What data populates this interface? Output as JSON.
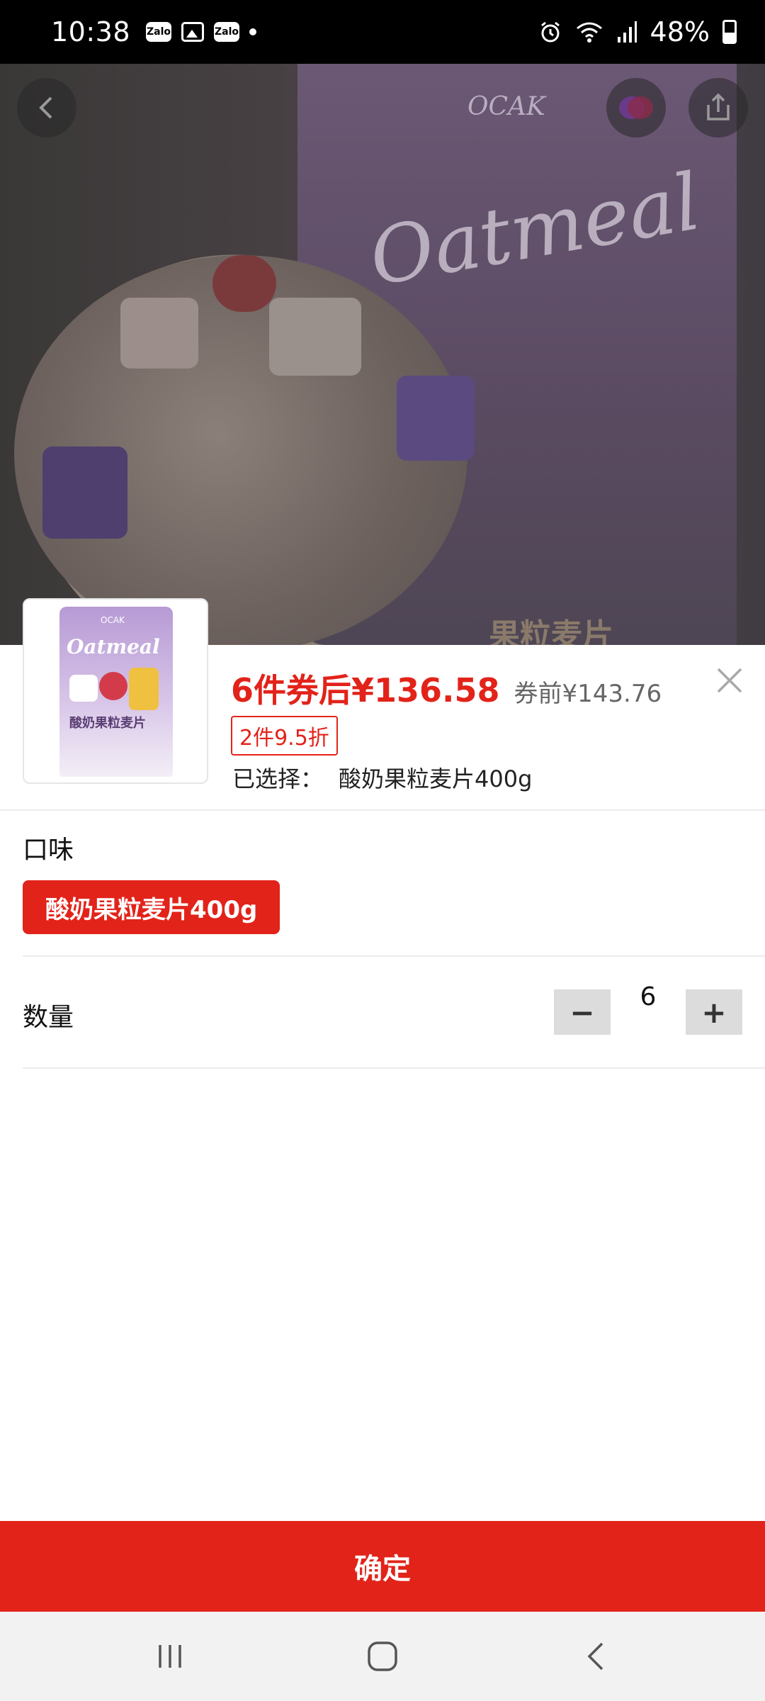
{
  "status_bar": {
    "time": "10:38",
    "notifications": [
      "zalo-icon",
      "gallery-icon",
      "zalo-icon",
      "dot-icon"
    ],
    "zalo_text": "Zalo",
    "battery": "48%",
    "icons": [
      "alarm-icon",
      "wifi-icon",
      "signal-icon",
      "battery-icon"
    ]
  },
  "hero": {
    "brand": "OCAK",
    "script_text": "Oatmeal",
    "package_text": "果粒麦片",
    "buttons": [
      "back-icon",
      "chat-icon",
      "share-icon"
    ]
  },
  "sheet": {
    "price_main": "6件券后¥136.58",
    "price_before": "券前¥143.76",
    "discount_tag": "2件9.5折",
    "selected_label": "已选择：",
    "selected_value": "酸奶果粒麦片400g",
    "flavor_label": "口味",
    "flavor_option": "酸奶果粒麦片400g",
    "quantity_label": "数量",
    "quantity_value": "6",
    "minus_symbol": "−",
    "plus_symbol": "+",
    "thumb_brand": "OCAK",
    "thumb_script": "Oatmeal",
    "thumb_name": "酸奶果粒麦片"
  },
  "confirm_button": "确定",
  "navbar": [
    "recents-icon",
    "home-icon",
    "back-nav-icon"
  ],
  "colors": {
    "accent": "#e2231a",
    "divider": "#ececec",
    "stepper": "#dcdcdc"
  }
}
